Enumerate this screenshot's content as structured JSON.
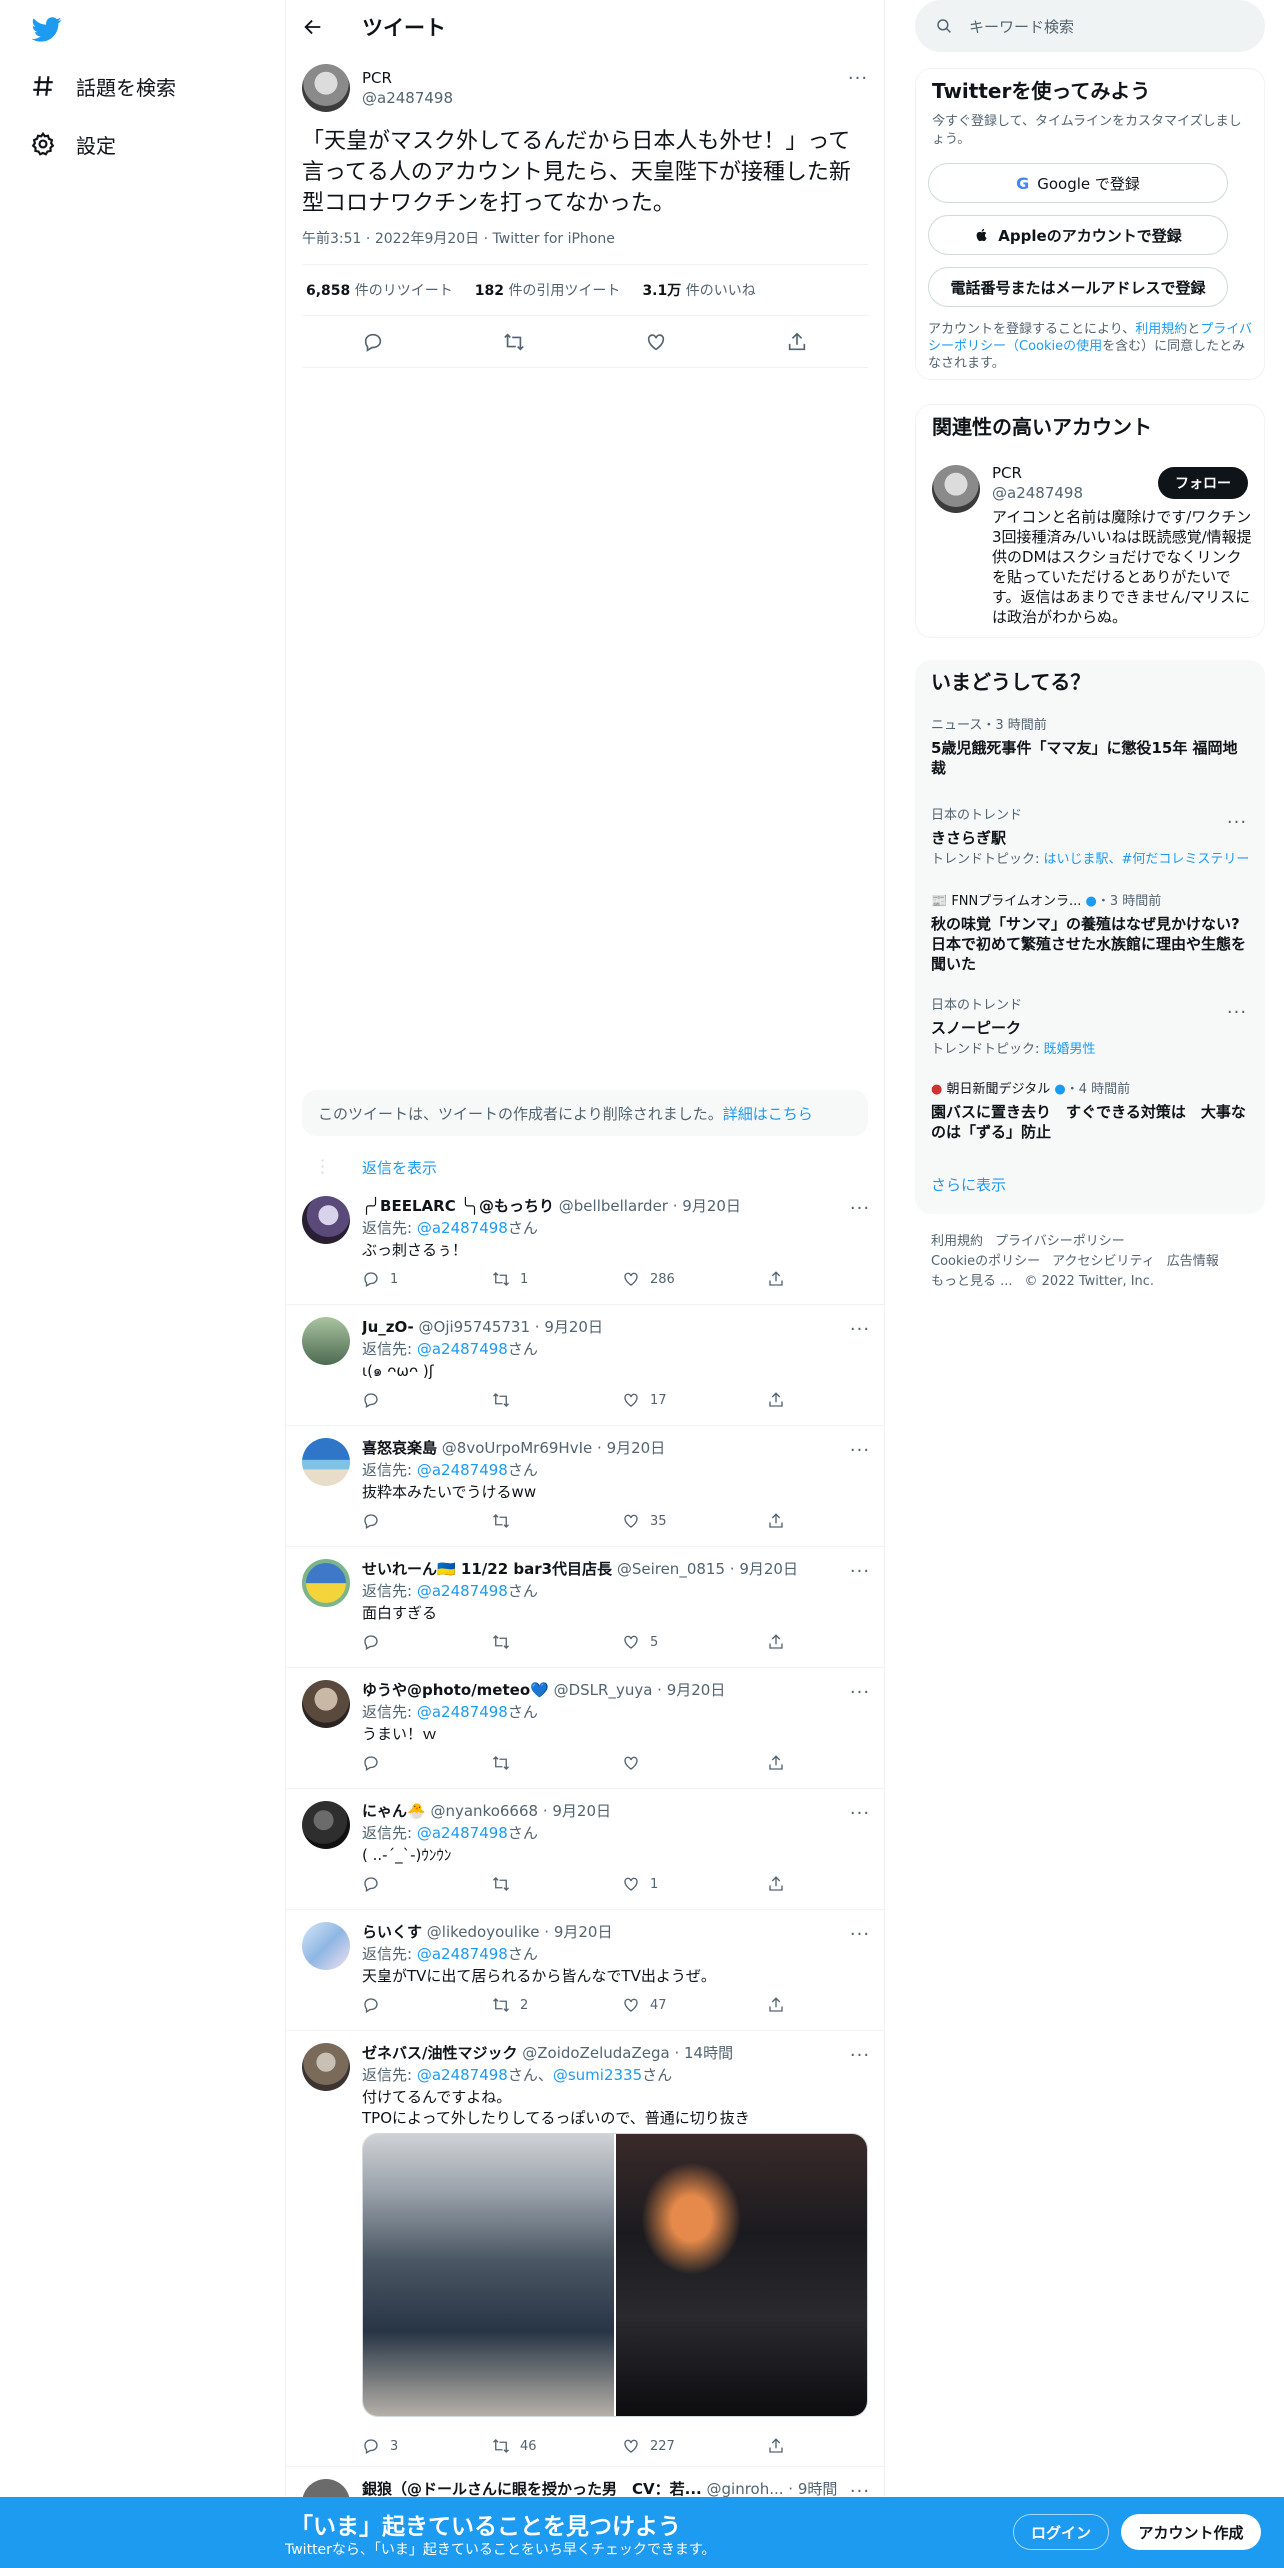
{
  "nav": {
    "explore": "話題を検索",
    "settings": "設定"
  },
  "header": {
    "title": "ツイート"
  },
  "main_tweet": {
    "name": "PCR",
    "handle": "@a2487498",
    "text": "「天皇がマスク外してるんだから日本人も外せ！」って言ってる人のアカウント見たら、天皇陛下が接種した新型コロナワクチンを打ってなかった。",
    "time": "午前3:51",
    "date": "2022年9月20日",
    "client": "Twitter for iPhone",
    "retweets": "6,858",
    "retweets_label": "件のリツイート",
    "quotes": "182",
    "quotes_label": "件の引用ツイート",
    "likes": "3.1万",
    "likes_label": "件のいいね"
  },
  "deleted": {
    "text": "このツイートは、ツイートの作成者により削除されました。",
    "link": "詳細はこちら"
  },
  "show_replies": "返信を表示",
  "replies": [
    {
      "name": "╭╯BEELARC ╰╮@もっちり",
      "handle": "@bellbellarder",
      "date": "9月20日",
      "to_label": "返信先: ",
      "to": "@a2487498",
      "to_suffix": "さん",
      "text": "ぶっ刺さるぅ！",
      "replies": "1",
      "retweets": "1",
      "likes": "286"
    },
    {
      "name": "Ju_zO-",
      "handle": "@Oji95745731",
      "date": "9月20日",
      "to_label": "返信先: ",
      "to": "@a2487498",
      "to_suffix": "さん",
      "text": "ι(๑ ᴖωᴖ )ʃ",
      "replies": "",
      "retweets": "",
      "likes": "17"
    },
    {
      "name": "喜怒哀楽島",
      "handle": "@8voUrpoMr69HvIe",
      "date": "9月20日",
      "to_label": "返信先: ",
      "to": "@a2487498",
      "to_suffix": "さん",
      "text": "抜粋本みたいでうけるww",
      "replies": "",
      "retweets": "",
      "likes": "35"
    },
    {
      "name": "せいれーん🇺🇦 11/22 bar3代目店長",
      "handle": "@Seiren_0815",
      "date": "9月20日",
      "to_label": "返信先: ",
      "to": "@a2487498",
      "to_suffix": "さん",
      "text": "面白すぎる",
      "replies": "",
      "retweets": "",
      "likes": "5"
    },
    {
      "name": "ゆうや@photo/meteo💙",
      "handle": "@DSLR_yuya",
      "date": "9月20日",
      "to_label": "返信先: ",
      "to": "@a2487498",
      "to_suffix": "さん",
      "text": "うまい！ｗ",
      "replies": "",
      "retweets": "",
      "likes": ""
    },
    {
      "name": "にゃん🐣",
      "handle": "@nyanko6668",
      "date": "9月20日",
      "to_label": "返信先: ",
      "to": "@a2487498",
      "to_suffix": "さん",
      "text": "( ..-´_`-)ｳﾝｳﾝ",
      "replies": "",
      "retweets": "",
      "likes": "1"
    },
    {
      "name": "らいくす",
      "handle": "@likedoyoulike",
      "date": "9月20日",
      "to_label": "返信先: ",
      "to": "@a2487498",
      "to_suffix": "さん",
      "text": "天皇がTVに出て居られるから皆んなでTV出ようぜ。",
      "replies": "",
      "retweets": "2",
      "likes": "47"
    },
    {
      "name": "ゼネバス/油性マジック",
      "handle": "@ZoidoZeludaZega",
      "date": "14時間",
      "to_label": "返信先: ",
      "to": "@a2487498",
      "to_mid": "さん、",
      "to2": "@sumi2335",
      "to_suffix": "さん",
      "text": "付けてるんですよね。\nTPOによって外したりしてるっぽいので、普通に切り抜き",
      "replies": "3",
      "retweets": "46",
      "likes": "227"
    },
    {
      "name": "銀狼（@ドールさんに眼を授かった男　CV：若...",
      "handle": "@ginroh...",
      "date": "9時間"
    }
  ],
  "right": {
    "search_placeholder": "キーワード検索",
    "signup": {
      "title": "Twitterを使ってみよう",
      "subtitle": "今すぐ登録して、タイムラインをカスタマイズしましょう。",
      "google": "Google で登録",
      "apple": "Appleのアカウントで登録",
      "phone": "電話番号またはメールアドレスで登録",
      "terms_pre": "アカウントを登録することにより、",
      "terms_link1": "利用規約",
      "terms_mid": "と",
      "terms_link2": "プライバシーポリシー（Cookieの使用",
      "terms_post": "を含む）に同意したとみなされます。"
    },
    "related": {
      "title": "関連性の高いアカウント",
      "name": "PCR",
      "handle": "@a2487498",
      "follow": "フォロー",
      "bio": "アイコンと名前は魔除けです/ワクチン3回接種済み/いいねは既読感覚/情報提供のDMはスクショだけでなくリンクを貼っていただけるとありがたいです。返信はあまりできません/マリスには政治がわからぬ。"
    },
    "trends": {
      "title": "いまどうしてる？",
      "items": [
        {
          "meta": "ニュース・3 時間前",
          "title": "5歳児餓死事件「ママ友」に懲役15年 福岡地裁",
          "sub": ""
        },
        {
          "meta": "日本のトレンド",
          "title": "きさらぎ駅",
          "sub_label": "トレンドトピック: ",
          "sub": "はいじま駅、#何だコレミステリー"
        },
        {
          "meta": "FNNプライムオンラ...",
          "meta2": "・3 時間前",
          "title": "秋の味覚「サンマ」の養殖はなぜ見かけない? 日本で初めて繁殖させた水族館に理由や生態を聞いた",
          "sub": ""
        },
        {
          "meta": "日本のトレンド",
          "title": "スノーピーク",
          "sub_label": "トレンドトピック: ",
          "sub": "既婚男性"
        },
        {
          "meta": "朝日新聞デジタル",
          "meta2": "・4 時間前",
          "title": "園バスに置き去り　すぐできる対策は　大事なのは「ずる」防止",
          "sub": ""
        }
      ],
      "more": "さらに表示"
    },
    "footer": [
      "利用規約",
      "プライバシーポリシー",
      "Cookieのポリシー",
      "アクセシビリティ",
      "広告情報",
      "もっと見る ...",
      "© 2022 Twitter, Inc."
    ]
  },
  "bottom": {
    "title": "「いま」起きていることを見つけよう",
    "subtitle": "Twitterなら、「いま」起きていることをいち早くチェックできます。",
    "login": "ログイン",
    "signup": "アカウント作成"
  },
  "colors": {
    "accent": "#1d9bf0",
    "text": "#0f1419",
    "muted": "#536471"
  }
}
